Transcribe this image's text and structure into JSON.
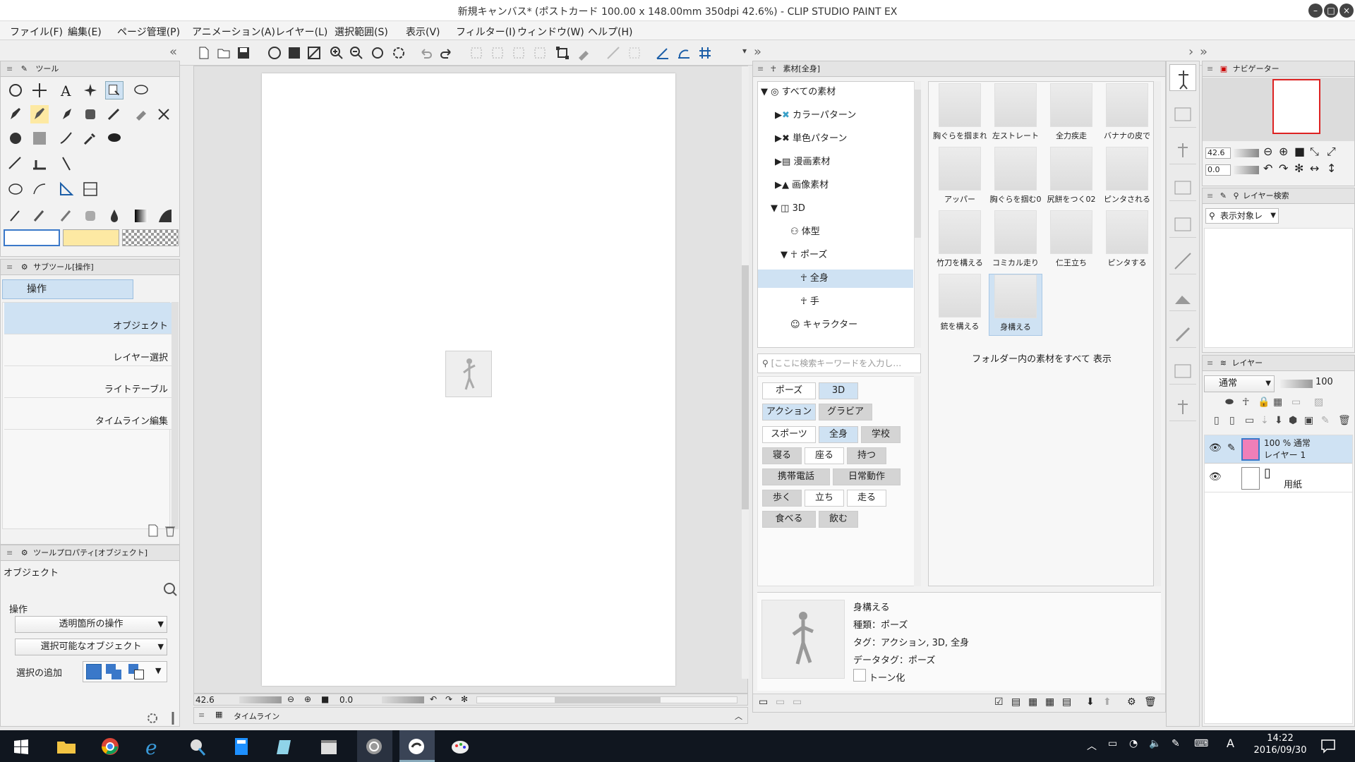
{
  "window": {
    "title": "新規キャンバス* (ポストカード 100.00 x 148.00mm 350dpi 42.6%) - CLIP STUDIO PAINT EX"
  },
  "menu": [
    "ファイル(F)",
    "編集(E)",
    "ページ管理(P)",
    "アニメーション(A)",
    "レイヤー(L)",
    "選択範囲(S)",
    "表示(V)",
    "フィルター(I)",
    "ウィンドウ(W)",
    "ヘルプ(H)"
  ],
  "tool_panel": {
    "title": "ツール"
  },
  "subtool_panel": {
    "title": "サブツール[操作]",
    "group": "操作",
    "items": [
      "オブジェクト",
      "レイヤー選択",
      "ライトテーブル",
      "タイムライン編集"
    ]
  },
  "toolprop_panel": {
    "title": "ツールプロパティ[オブジェクト]",
    "name": "オブジェクト",
    "section": "操作",
    "dropdown1": "透明箇所の操作",
    "dropdown2": "選択可能なオブジェクト",
    "add_selection_label": "選択の追加"
  },
  "canvas_status": {
    "zoom": "42.6",
    "angle": "0.0"
  },
  "timeline": {
    "label": "タイムライン"
  },
  "material_panel": {
    "title": "素材[全身]",
    "tree": [
      {
        "label": "すべての素材"
      },
      {
        "label": "カラーパターン"
      },
      {
        "label": "単色パターン"
      },
      {
        "label": "漫画素材"
      },
      {
        "label": "画像素材"
      },
      {
        "label": "3D"
      },
      {
        "label": "体型"
      },
      {
        "label": "ポーズ"
      },
      {
        "label": "全身"
      },
      {
        "label": "手"
      },
      {
        "label": "キャラクター"
      }
    ],
    "search_placeholder": "[ここに検索キーワードを入力し…",
    "tags": [
      "ポーズ",
      "3D",
      "アクション",
      "グラビア",
      "スポーツ",
      "全身",
      "学校",
      "寝る",
      "座る",
      "持つ",
      "携帯電話",
      "日常動作",
      "歩く",
      "立ち",
      "走る",
      "食べる",
      "飲む"
    ],
    "thumbs": [
      "胸ぐらを掴まれ",
      "左ストレート",
      "全力疾走",
      "バナナの皮で",
      "アッパー",
      "胸ぐらを掴む0",
      "尻餅をつく02",
      "ピンタされる",
      "竹刀を構える",
      "コミカル走り",
      "仁王立ち",
      "ピンタする",
      "銃を構える",
      "身構える"
    ],
    "show_all": "フォルダー内の素材をすべて 表示",
    "detail": {
      "name": "身構える",
      "type": "種類：ポーズ",
      "tags": "タグ：アクション, 3D, 全身",
      "datatag": "データタグ：ポーズ",
      "tone": "トーン化"
    }
  },
  "navigator": {
    "title": "ナビゲーター",
    "zoom": "42.6",
    "angle": "0.0"
  },
  "layer_search": {
    "title": "レイヤー検索",
    "target": "表示対象レ"
  },
  "layer_panel": {
    "title": "レイヤー",
    "blend": "通常",
    "opacity": "100",
    "layers": [
      {
        "line1": "100 % 通常",
        "line2": "レイヤー 1"
      },
      {
        "line1": "",
        "line2": "用紙"
      }
    ]
  },
  "clock": {
    "time": "14:22",
    "date": "2016/09/30"
  },
  "ime": "A",
  "colors": {
    "accent": "#3a78c9",
    "selection": "#cfe2f3",
    "main_color": "#ffffff",
    "sub_color": "#fde9a3",
    "layer_pink": "#f07fb8"
  }
}
